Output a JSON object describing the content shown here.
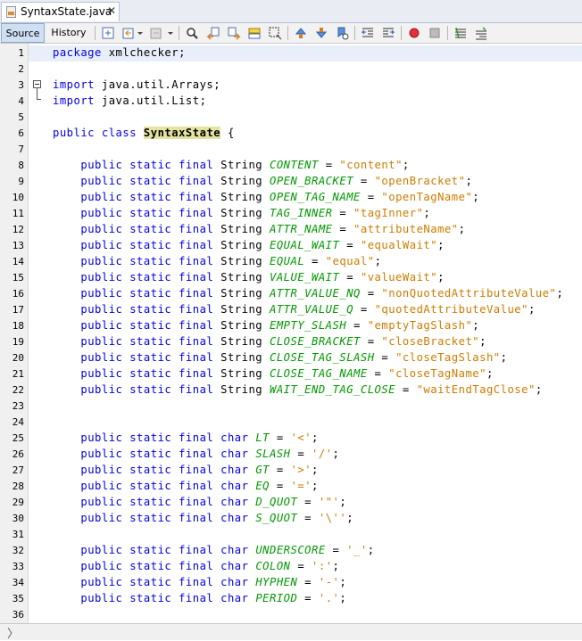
{
  "tab": {
    "title": "SyntaxState.java",
    "close": "✕"
  },
  "toolbar": {
    "source_label": "Source",
    "history_label": "History"
  },
  "status": {
    "expand": "〉"
  },
  "lines": [
    {
      "n": "1",
      "code": [
        {
          "t": "package",
          "c": "kw"
        },
        {
          "t": " xmlchecker;"
        }
      ]
    },
    {
      "n": "2",
      "code": []
    },
    {
      "n": "3",
      "code": [
        {
          "t": "import",
          "c": "kw"
        },
        {
          "t": " java.util.Arrays;"
        }
      ]
    },
    {
      "n": "4",
      "code": [
        {
          "t": "import",
          "c": "kw"
        },
        {
          "t": " java.util.List;"
        }
      ]
    },
    {
      "n": "5",
      "code": []
    },
    {
      "n": "6",
      "code": [
        {
          "t": "public class",
          "c": "kw"
        },
        {
          "t": " "
        },
        {
          "t": "SyntaxState",
          "c": "cls"
        },
        {
          "t": " {"
        }
      ]
    },
    {
      "n": "7",
      "code": []
    },
    {
      "n": "8",
      "code": [
        {
          "t": "    "
        },
        {
          "t": "public static final",
          "c": "kw"
        },
        {
          "t": " String "
        },
        {
          "t": "CONTENT",
          "c": "fld"
        },
        {
          "t": " = "
        },
        {
          "t": "\"content\"",
          "c": "str"
        },
        {
          "t": ";"
        }
      ]
    },
    {
      "n": "9",
      "code": [
        {
          "t": "    "
        },
        {
          "t": "public static final",
          "c": "kw"
        },
        {
          "t": " String "
        },
        {
          "t": "OPEN_BRACKET",
          "c": "fld"
        },
        {
          "t": " = "
        },
        {
          "t": "\"openBracket\"",
          "c": "str"
        },
        {
          "t": ";"
        }
      ]
    },
    {
      "n": "10",
      "code": [
        {
          "t": "    "
        },
        {
          "t": "public static final",
          "c": "kw"
        },
        {
          "t": " String "
        },
        {
          "t": "OPEN_TAG_NAME",
          "c": "fld"
        },
        {
          "t": " = "
        },
        {
          "t": "\"openTagName\"",
          "c": "str"
        },
        {
          "t": ";"
        }
      ]
    },
    {
      "n": "11",
      "code": [
        {
          "t": "    "
        },
        {
          "t": "public static final",
          "c": "kw"
        },
        {
          "t": " String "
        },
        {
          "t": "TAG_INNER",
          "c": "fld"
        },
        {
          "t": " = "
        },
        {
          "t": "\"tagInner\"",
          "c": "str"
        },
        {
          "t": ";"
        }
      ]
    },
    {
      "n": "12",
      "code": [
        {
          "t": "    "
        },
        {
          "t": "public static final",
          "c": "kw"
        },
        {
          "t": " String "
        },
        {
          "t": "ATTR_NAME",
          "c": "fld"
        },
        {
          "t": " = "
        },
        {
          "t": "\"attributeName\"",
          "c": "str"
        },
        {
          "t": ";"
        }
      ]
    },
    {
      "n": "13",
      "code": [
        {
          "t": "    "
        },
        {
          "t": "public static final",
          "c": "kw"
        },
        {
          "t": " String "
        },
        {
          "t": "EQUAL_WAIT",
          "c": "fld"
        },
        {
          "t": " = "
        },
        {
          "t": "\"equalWait\"",
          "c": "str"
        },
        {
          "t": ";"
        }
      ]
    },
    {
      "n": "14",
      "code": [
        {
          "t": "    "
        },
        {
          "t": "public static final",
          "c": "kw"
        },
        {
          "t": " String "
        },
        {
          "t": "EQUAL",
          "c": "fld"
        },
        {
          "t": " = "
        },
        {
          "t": "\"equal\"",
          "c": "str"
        },
        {
          "t": ";"
        }
      ]
    },
    {
      "n": "15",
      "code": [
        {
          "t": "    "
        },
        {
          "t": "public static final",
          "c": "kw"
        },
        {
          "t": " String "
        },
        {
          "t": "VALUE_WAIT",
          "c": "fld"
        },
        {
          "t": " = "
        },
        {
          "t": "\"valueWait\"",
          "c": "str"
        },
        {
          "t": ";"
        }
      ]
    },
    {
      "n": "16",
      "code": [
        {
          "t": "    "
        },
        {
          "t": "public static final",
          "c": "kw"
        },
        {
          "t": " String "
        },
        {
          "t": "ATTR_VALUE_NQ",
          "c": "fld"
        },
        {
          "t": " = "
        },
        {
          "t": "\"nonQuotedAttributeValue\"",
          "c": "str"
        },
        {
          "t": ";"
        }
      ]
    },
    {
      "n": "17",
      "code": [
        {
          "t": "    "
        },
        {
          "t": "public static final",
          "c": "kw"
        },
        {
          "t": " String "
        },
        {
          "t": "ATTR_VALUE_Q",
          "c": "fld"
        },
        {
          "t": " = "
        },
        {
          "t": "\"quotedAttributeValue\"",
          "c": "str"
        },
        {
          "t": ";"
        }
      ]
    },
    {
      "n": "18",
      "code": [
        {
          "t": "    "
        },
        {
          "t": "public static final",
          "c": "kw"
        },
        {
          "t": " String "
        },
        {
          "t": "EMPTY_SLASH",
          "c": "fld"
        },
        {
          "t": " = "
        },
        {
          "t": "\"emptyTagSlash\"",
          "c": "str"
        },
        {
          "t": ";"
        }
      ]
    },
    {
      "n": "19",
      "code": [
        {
          "t": "    "
        },
        {
          "t": "public static final",
          "c": "kw"
        },
        {
          "t": " String "
        },
        {
          "t": "CLOSE_BRACKET",
          "c": "fld"
        },
        {
          "t": " = "
        },
        {
          "t": "\"closeBracket\"",
          "c": "str"
        },
        {
          "t": ";"
        }
      ]
    },
    {
      "n": "20",
      "code": [
        {
          "t": "    "
        },
        {
          "t": "public static final",
          "c": "kw"
        },
        {
          "t": " String "
        },
        {
          "t": "CLOSE_TAG_SLASH",
          "c": "fld"
        },
        {
          "t": " = "
        },
        {
          "t": "\"closeTagSlash\"",
          "c": "str"
        },
        {
          "t": ";"
        }
      ]
    },
    {
      "n": "21",
      "code": [
        {
          "t": "    "
        },
        {
          "t": "public static final",
          "c": "kw"
        },
        {
          "t": " String "
        },
        {
          "t": "CLOSE_TAG_NAME",
          "c": "fld"
        },
        {
          "t": " = "
        },
        {
          "t": "\"closeTagName\"",
          "c": "str"
        },
        {
          "t": ";"
        }
      ]
    },
    {
      "n": "22",
      "code": [
        {
          "t": "    "
        },
        {
          "t": "public static final",
          "c": "kw"
        },
        {
          "t": " String "
        },
        {
          "t": "WAIT_END_TAG_CLOSE",
          "c": "fld"
        },
        {
          "t": " = "
        },
        {
          "t": "\"waitEndTagClose\"",
          "c": "str"
        },
        {
          "t": ";"
        }
      ]
    },
    {
      "n": "23",
      "code": []
    },
    {
      "n": "24",
      "code": []
    },
    {
      "n": "25",
      "code": [
        {
          "t": "    "
        },
        {
          "t": "public static final char",
          "c": "kw"
        },
        {
          "t": " "
        },
        {
          "t": "LT",
          "c": "fld"
        },
        {
          "t": " = "
        },
        {
          "t": "'<'",
          "c": "str"
        },
        {
          "t": ";"
        }
      ]
    },
    {
      "n": "26",
      "code": [
        {
          "t": "    "
        },
        {
          "t": "public static final char",
          "c": "kw"
        },
        {
          "t": " "
        },
        {
          "t": "SLASH",
          "c": "fld"
        },
        {
          "t": " = "
        },
        {
          "t": "'/'",
          "c": "str"
        },
        {
          "t": ";"
        }
      ]
    },
    {
      "n": "27",
      "code": [
        {
          "t": "    "
        },
        {
          "t": "public static final char",
          "c": "kw"
        },
        {
          "t": " "
        },
        {
          "t": "GT",
          "c": "fld"
        },
        {
          "t": " = "
        },
        {
          "t": "'>'",
          "c": "str"
        },
        {
          "t": ";"
        }
      ]
    },
    {
      "n": "28",
      "code": [
        {
          "t": "    "
        },
        {
          "t": "public static final char",
          "c": "kw"
        },
        {
          "t": " "
        },
        {
          "t": "EQ",
          "c": "fld"
        },
        {
          "t": " = "
        },
        {
          "t": "'='",
          "c": "str"
        },
        {
          "t": ";"
        }
      ]
    },
    {
      "n": "29",
      "code": [
        {
          "t": "    "
        },
        {
          "t": "public static final char",
          "c": "kw"
        },
        {
          "t": " "
        },
        {
          "t": "D_QUOT",
          "c": "fld"
        },
        {
          "t": " = "
        },
        {
          "t": "'\"'",
          "c": "str"
        },
        {
          "t": ";"
        }
      ]
    },
    {
      "n": "30",
      "code": [
        {
          "t": "    "
        },
        {
          "t": "public static final char",
          "c": "kw"
        },
        {
          "t": " "
        },
        {
          "t": "S_QUOT",
          "c": "fld"
        },
        {
          "t": " = "
        },
        {
          "t": "'\\''",
          "c": "str"
        },
        {
          "t": ";"
        }
      ]
    },
    {
      "n": "31",
      "code": []
    },
    {
      "n": "32",
      "code": [
        {
          "t": "    "
        },
        {
          "t": "public static final char",
          "c": "kw"
        },
        {
          "t": " "
        },
        {
          "t": "UNDERSCORE",
          "c": "fld"
        },
        {
          "t": " = "
        },
        {
          "t": "'_'",
          "c": "str"
        },
        {
          "t": ";"
        }
      ]
    },
    {
      "n": "33",
      "code": [
        {
          "t": "    "
        },
        {
          "t": "public static final char",
          "c": "kw"
        },
        {
          "t": " "
        },
        {
          "t": "COLON",
          "c": "fld"
        },
        {
          "t": " = "
        },
        {
          "t": "':'",
          "c": "str"
        },
        {
          "t": ";"
        }
      ]
    },
    {
      "n": "34",
      "code": [
        {
          "t": "    "
        },
        {
          "t": "public static final char",
          "c": "kw"
        },
        {
          "t": " "
        },
        {
          "t": "HYPHEN",
          "c": "fld"
        },
        {
          "t": " = "
        },
        {
          "t": "'-'",
          "c": "str"
        },
        {
          "t": ";"
        }
      ]
    },
    {
      "n": "35",
      "code": [
        {
          "t": "    "
        },
        {
          "t": "public static final char",
          "c": "kw"
        },
        {
          "t": " "
        },
        {
          "t": "PERIOD",
          "c": "fld"
        },
        {
          "t": " = "
        },
        {
          "t": "'.'",
          "c": "str"
        },
        {
          "t": ";"
        }
      ]
    },
    {
      "n": "36",
      "code": []
    }
  ]
}
